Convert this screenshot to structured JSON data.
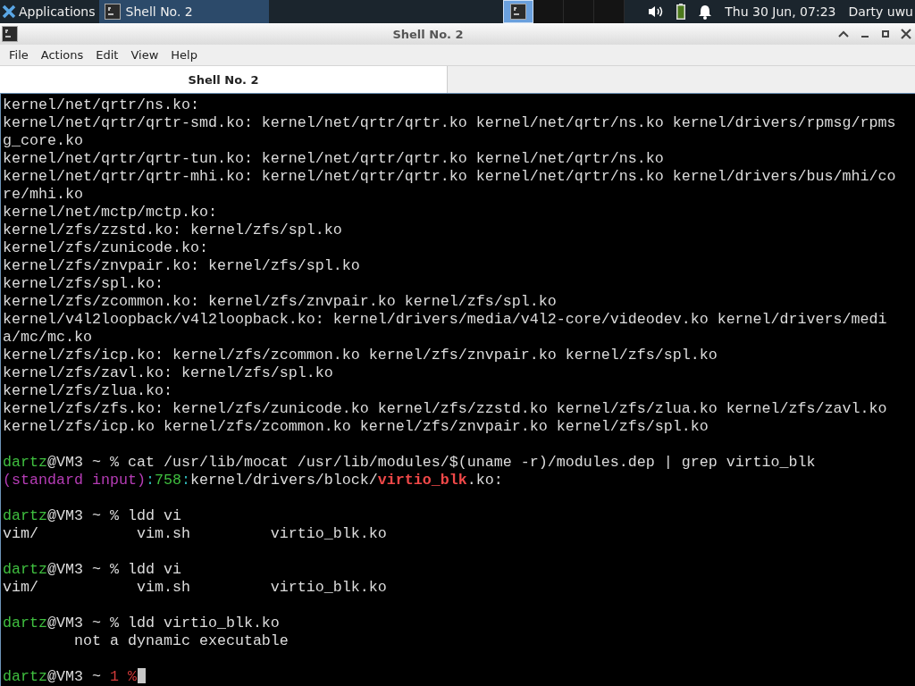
{
  "panel": {
    "menu": "Applications",
    "tasks": [
      {
        "label": "Shell No. 2",
        "selected": true
      }
    ],
    "workspaces": [
      {
        "selected": true,
        "has_window": true
      },
      {
        "selected": false,
        "has_window": false
      },
      {
        "selected": false,
        "has_window": false
      },
      {
        "selected": false,
        "has_window": false
      }
    ],
    "clock": "Thu 30 Jun, 07:23",
    "user": "Darty uwu"
  },
  "window": {
    "title": "Shell No. 2"
  },
  "menu": [
    "File",
    "Actions",
    "Edit",
    "View",
    "Help"
  ],
  "tabs": [
    {
      "label": "Shell No. 2",
      "selected": true
    }
  ],
  "terminal": {
    "cursor": true,
    "lines": [
      {
        "kind": "output",
        "segments": [
          {
            "kind": "text",
            "text": "kernel/net/qrtr/ns.ko:"
          }
        ]
      },
      {
        "kind": "output",
        "segments": [
          {
            "kind": "text",
            "text": "kernel/net/qrtr/qrtr-smd.ko: kernel/net/qrtr/qrtr.ko kernel/net/qrtr/ns.ko kernel/drivers/rpmsg/rpmsg_core.ko"
          }
        ]
      },
      {
        "kind": "output",
        "segments": [
          {
            "kind": "text",
            "text": "kernel/net/qrtr/qrtr-tun.ko: kernel/net/qrtr/qrtr.ko kernel/net/qrtr/ns.ko"
          }
        ]
      },
      {
        "kind": "output",
        "segments": [
          {
            "kind": "text",
            "text": "kernel/net/qrtr/qrtr-mhi.ko: kernel/net/qrtr/qrtr.ko kernel/net/qrtr/ns.ko kernel/drivers/bus/mhi/core/mhi.ko"
          }
        ]
      },
      {
        "kind": "output",
        "segments": [
          {
            "kind": "text",
            "text": "kernel/net/mctp/mctp.ko:"
          }
        ]
      },
      {
        "kind": "output",
        "segments": [
          {
            "kind": "text",
            "text": "kernel/zfs/zzstd.ko: kernel/zfs/spl.ko"
          }
        ]
      },
      {
        "kind": "output",
        "segments": [
          {
            "kind": "text",
            "text": "kernel/zfs/zunicode.ko:"
          }
        ]
      },
      {
        "kind": "output",
        "segments": [
          {
            "kind": "text",
            "text": "kernel/zfs/znvpair.ko: kernel/zfs/spl.ko"
          }
        ]
      },
      {
        "kind": "output",
        "segments": [
          {
            "kind": "text",
            "text": "kernel/zfs/spl.ko:"
          }
        ]
      },
      {
        "kind": "output",
        "segments": [
          {
            "kind": "text",
            "text": "kernel/zfs/zcommon.ko: kernel/zfs/znvpair.ko kernel/zfs/spl.ko"
          }
        ]
      },
      {
        "kind": "output",
        "segments": [
          {
            "kind": "text",
            "text": "kernel/v4l2loopback/v4l2loopback.ko: kernel/drivers/media/v4l2-core/videodev.ko kernel/drivers/media/mc/mc.ko"
          }
        ]
      },
      {
        "kind": "output",
        "segments": [
          {
            "kind": "text",
            "text": "kernel/zfs/icp.ko: kernel/zfs/zcommon.ko kernel/zfs/znvpair.ko kernel/zfs/spl.ko"
          }
        ]
      },
      {
        "kind": "output",
        "segments": [
          {
            "kind": "text",
            "text": "kernel/zfs/zavl.ko: kernel/zfs/spl.ko"
          }
        ]
      },
      {
        "kind": "output",
        "segments": [
          {
            "kind": "text",
            "text": "kernel/zfs/zlua.ko:"
          }
        ]
      },
      {
        "kind": "output",
        "segments": [
          {
            "kind": "text",
            "text": "kernel/zfs/zfs.ko: kernel/zfs/zunicode.ko kernel/zfs/zzstd.ko kernel/zfs/zlua.ko kernel/zfs/zavl.ko kernel/zfs/icp.ko kernel/zfs/zcommon.ko kernel/zfs/znvpair.ko kernel/zfs/spl.ko"
          }
        ]
      },
      {
        "kind": "blank"
      },
      {
        "kind": "prompt",
        "segments": [
          {
            "kind": "user",
            "text": "dartz"
          },
          {
            "kind": "text",
            "text": "@VM3 ~ % cat /usr/lib/mocat /usr/lib/modules/$(uname -r)/modules.dep | grep virtio_blk"
          }
        ]
      },
      {
        "kind": "output",
        "segments": [
          {
            "kind": "filename",
            "text": "(standard input)"
          },
          {
            "kind": "separator",
            "text": ":"
          },
          {
            "kind": "lineno",
            "text": "758"
          },
          {
            "kind": "separator",
            "text": ":"
          },
          {
            "kind": "text",
            "text": "kernel/drivers/block/"
          },
          {
            "kind": "match",
            "text": "virtio_blk"
          },
          {
            "kind": "text",
            "text": ".ko:"
          }
        ]
      },
      {
        "kind": "blank"
      },
      {
        "kind": "prompt",
        "segments": [
          {
            "kind": "user",
            "text": "dartz"
          },
          {
            "kind": "text",
            "text": "@VM3 ~ % ldd vi"
          }
        ]
      },
      {
        "kind": "output",
        "segments": [
          {
            "kind": "text",
            "text": "vim/           vim.sh         virtio_blk.ko"
          }
        ]
      },
      {
        "kind": "blank"
      },
      {
        "kind": "prompt",
        "segments": [
          {
            "kind": "user",
            "text": "dartz"
          },
          {
            "kind": "text",
            "text": "@VM3 ~ % ldd vi"
          }
        ]
      },
      {
        "kind": "output",
        "segments": [
          {
            "kind": "text",
            "text": "vim/           vim.sh         virtio_blk.ko"
          }
        ]
      },
      {
        "kind": "blank"
      },
      {
        "kind": "prompt",
        "segments": [
          {
            "kind": "user",
            "text": "dartz"
          },
          {
            "kind": "text",
            "text": "@VM3 ~ % ldd virtio_blk.ko"
          }
        ]
      },
      {
        "kind": "output",
        "segments": [
          {
            "kind": "text",
            "text": "        not a dynamic executable"
          }
        ]
      },
      {
        "kind": "blank"
      },
      {
        "kind": "prompt",
        "segments": [
          {
            "kind": "user",
            "text": "dartz"
          },
          {
            "kind": "text",
            "text": "@VM3 ~ "
          },
          {
            "kind": "status",
            "text": "1 %"
          }
        ]
      }
    ]
  }
}
